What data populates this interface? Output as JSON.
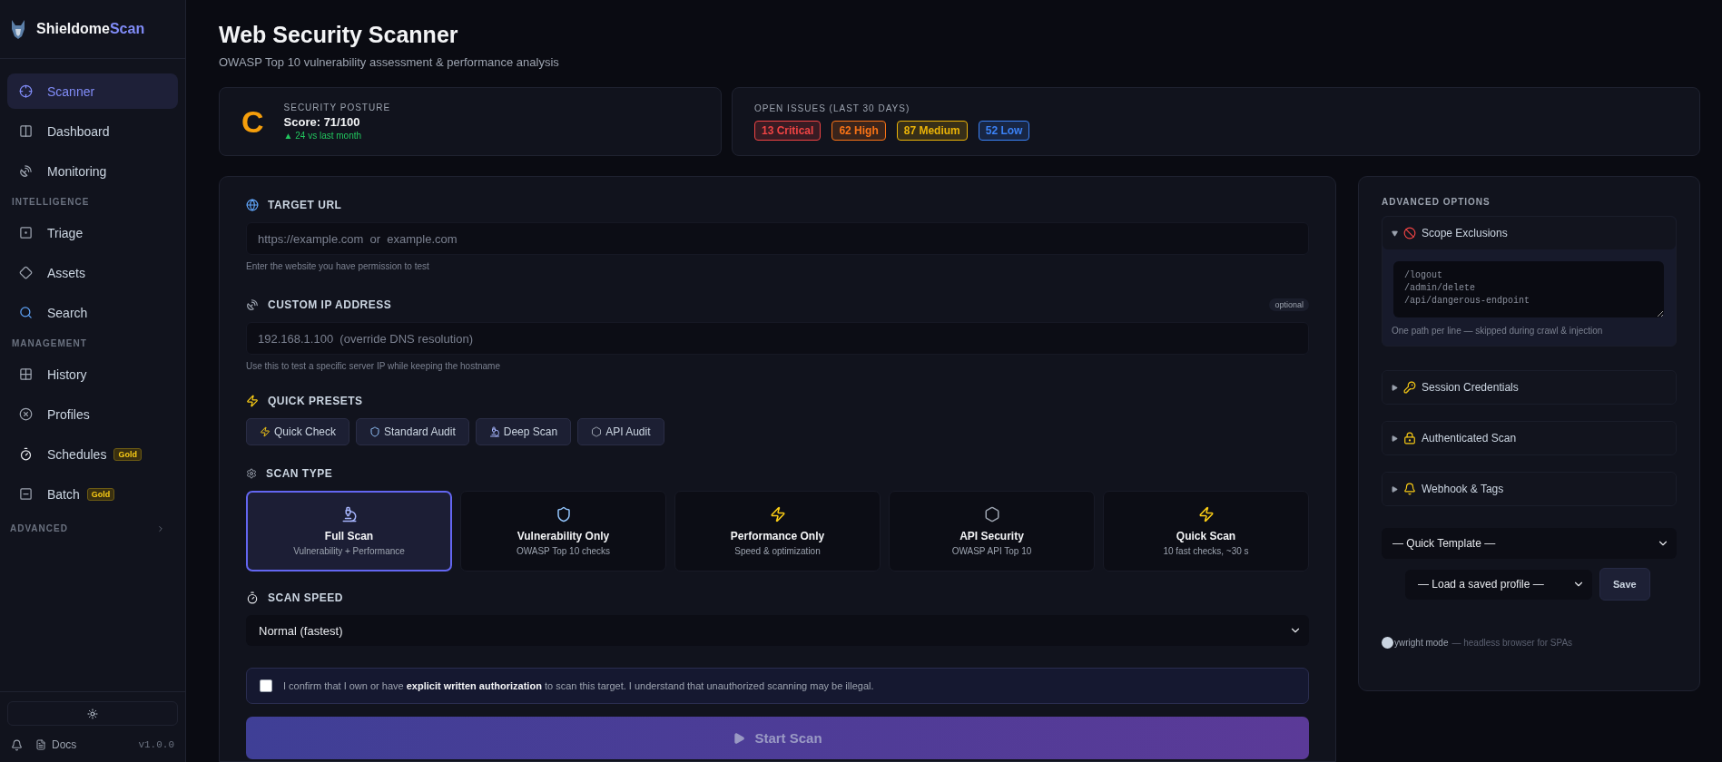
{
  "sidebar": {
    "brand": {
      "name": "Shieldome",
      "accent": "Scan"
    },
    "sections": [
      {
        "items": [
          {
            "label": "Scanner",
            "selected": true
          },
          {
            "label": "Dashboard",
            "selected": false
          },
          {
            "label": "Monitoring",
            "selected": false
          }
        ]
      },
      {
        "title": "INTELLIGENCE",
        "items": [
          {
            "label": "Triage",
            "selected": false
          },
          {
            "label": "Assets",
            "selected": false
          },
          {
            "label": "Search",
            "selected": false
          }
        ]
      },
      {
        "title": "MANAGEMENT",
        "items": [
          {
            "label": "History",
            "selected": false
          },
          {
            "label": "Profiles",
            "selected": false
          },
          {
            "label": "Schedules",
            "selected": false,
            "badge": "Gold"
          },
          {
            "label": "Batch",
            "selected": false,
            "badge": "Gold"
          }
        ]
      }
    ],
    "advanced": {
      "title": "ADVANCED",
      "expanded": false
    },
    "footer": {
      "docs": "Docs",
      "version": "v1.0.0"
    }
  },
  "header": {
    "title": "Web Security Scanner",
    "subtitle": "OWASP Top 10 vulnerability assessment & performance analysis"
  },
  "posture": {
    "label": "SECURITY POSTURE",
    "grade": "C",
    "score": "Score: 71/100",
    "delta": "▲ 24 vs last month"
  },
  "issues": {
    "label": "OPEN ISSUES (LAST 30 DAYS)",
    "badges": [
      {
        "text": "13 Critical",
        "color": "#ef4444"
      },
      {
        "text": "62 High",
        "color": "#f97316"
      },
      {
        "text": "87 Medium",
        "color": "#eab308"
      },
      {
        "text": "52 Low",
        "color": "#3b82f6"
      }
    ]
  },
  "form": {
    "fields": [
      {
        "label": "TARGET URL",
        "placeholder": "https://example.com  or  example.com",
        "help": "Enter the website you have permission to test"
      },
      {
        "label": "CUSTOM IP ADDRESS",
        "badge": "optional",
        "placeholder": "192.168.1.100  (override DNS resolution)",
        "help": "Use this to test a specific server IP while keeping the hostname"
      }
    ],
    "presets": {
      "label": "QUICK PRESETS",
      "buttons": [
        {
          "label": "Quick Check"
        },
        {
          "label": "Standard Audit"
        },
        {
          "label": "Deep Scan"
        },
        {
          "label": "API Audit"
        }
      ]
    },
    "scan_type": {
      "label": "SCAN TYPE",
      "options": [
        {
          "title": "Full Scan",
          "subtitle": "Vulnerability + Performance",
          "selected": true
        },
        {
          "title": "Vulnerability Only",
          "subtitle": "OWASP Top 10 checks",
          "selected": false
        },
        {
          "title": "Performance Only",
          "subtitle": "Speed & optimization",
          "selected": false
        },
        {
          "title": "API Security",
          "subtitle": "OWASP API Top 10",
          "selected": false
        },
        {
          "title": "Quick Scan",
          "subtitle": "10 fast checks, ~30 s",
          "selected": false
        }
      ]
    },
    "speed": {
      "label": "SCAN SPEED",
      "value": "Normal (fastest)"
    },
    "consent": {
      "text": "I confirm that I own or have **explicit written authorization** to scan this target. I understand that unauthorized scanning may be illegal.",
      "checked": false
    },
    "start": {
      "label": "Start Scan"
    }
  },
  "advanced": {
    "title": "ADVANCED OPTIONS",
    "sections": [
      {
        "title": "Scope Exclusions",
        "expanded": true,
        "placeholder": "/logout\n/admin/delete\n/api/dangerous-endpoint",
        "help": "One path per line — skipped during crawl & injection"
      },
      {
        "title": "Session Credentials",
        "expanded": false
      },
      {
        "title": "Authenticated Scan",
        "expanded": false
      },
      {
        "title": "Webhook & Tags",
        "expanded": false
      }
    ],
    "template": {
      "value": "— Quick Template —"
    },
    "profile": {
      "value": "— Load a saved profile —",
      "save": "Save"
    },
    "playwright": {
      "label": "ywright mode",
      "hint": "— headless browser for SPAs",
      "on": false
    }
  }
}
